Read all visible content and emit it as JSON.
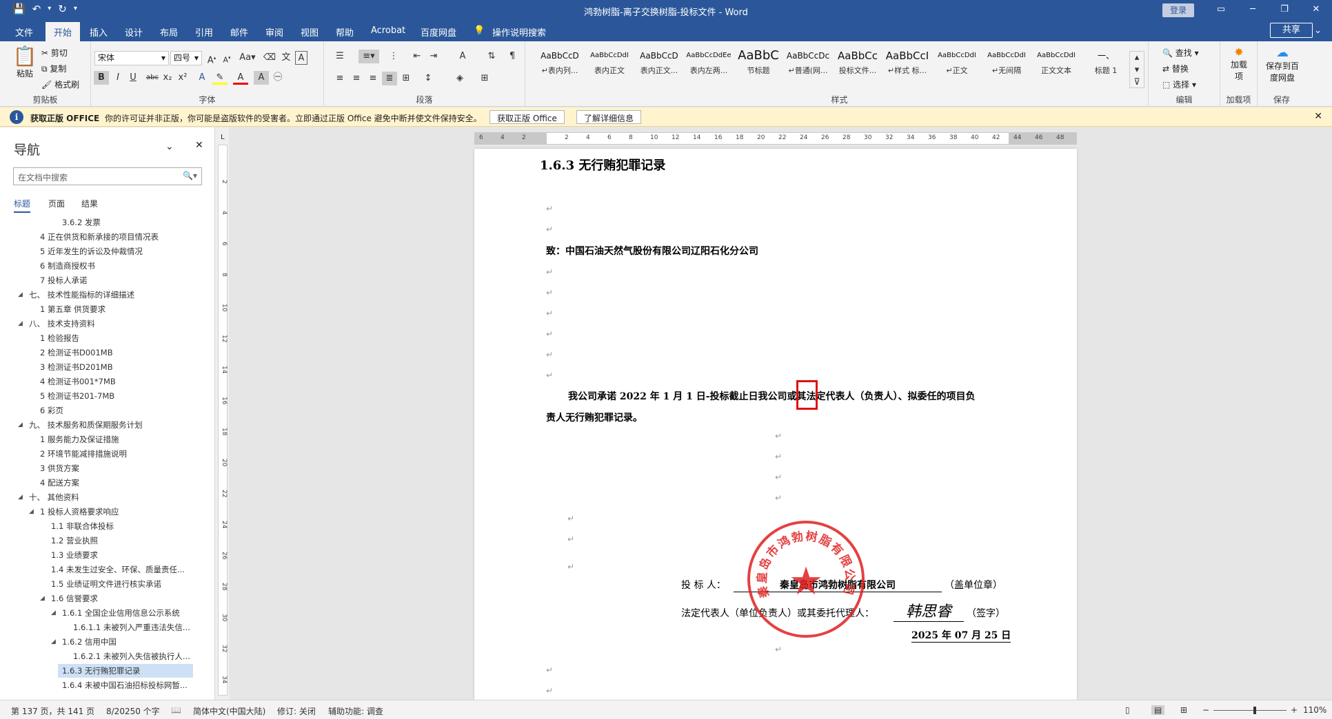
{
  "window": {
    "title": "鸿勃树脂-离子交换树脂-投标文件  -  Word",
    "login": "登录"
  },
  "tabs": [
    "文件",
    "开始",
    "插入",
    "设计",
    "布局",
    "引用",
    "邮件",
    "审阅",
    "视图",
    "帮助",
    "Acrobat",
    "百度网盘"
  ],
  "tell_me": "操作说明搜索",
  "share": "共享",
  "clipboard": {
    "paste": "粘贴",
    "cut": "剪切",
    "copy": "复制",
    "format_painter": "格式刷",
    "label": "剪贴板"
  },
  "font": {
    "name": "宋体",
    "size": "四号",
    "label": "字体",
    "aa": "Aa"
  },
  "paragraph": {
    "label": "段落"
  },
  "styles": {
    "label": "样式",
    "items": [
      {
        "preview": "AaBbCcD",
        "name": "↵表内列..."
      },
      {
        "preview": "AaBbCcDdI",
        "name": "表内正文"
      },
      {
        "preview": "AaBbCcD",
        "name": "表内正文..."
      },
      {
        "preview": "AaBbCcDdEe",
        "name": "表内左两..."
      },
      {
        "preview": "AaBbC",
        "name": "节标题"
      },
      {
        "preview": "AaBbCcDc",
        "name": "↵普通(网..."
      },
      {
        "preview": "AaBbCc",
        "name": "投标文件..."
      },
      {
        "preview": "AaBbCcI",
        "name": "↵样式 标..."
      },
      {
        "preview": "AaBbCcDdI",
        "name": "↵正文"
      },
      {
        "preview": "AaBbCcDdI",
        "name": "↵无间隔"
      },
      {
        "preview": "AaBbCcDdI",
        "name": "正文文本"
      },
      {
        "preview": "一、",
        "name": "标题 1"
      }
    ]
  },
  "editing": {
    "find": "查找",
    "replace": "替换",
    "select": "选择",
    "label": "编辑"
  },
  "addins": {
    "title": "加载项",
    "label": "加载项"
  },
  "baidu": {
    "title": "保存到百度网盘",
    "label": "保存"
  },
  "infobar": {
    "title": "获取正版 OFFICE",
    "message": "你的许可证并非正版，你可能是盗版软件的受害者。立即通过正版 Office 避免中断并使文件保持安全。",
    "btn_genuine": "获取正版 Office",
    "btn_learn": "了解详细信息"
  },
  "nav": {
    "title": "导航",
    "search_placeholder": "在文档中搜索",
    "tabs": [
      "标题",
      "页面",
      "结果"
    ],
    "items": [
      {
        "text": "3.6.2 发票",
        "level": 4,
        "toggle": ""
      },
      {
        "text": "4 正在供货和新承接的项目情况表",
        "level": 2,
        "toggle": ""
      },
      {
        "text": "5 近年发生的诉讼及仲裁情况",
        "level": 2,
        "toggle": ""
      },
      {
        "text": "6 制造商授权书",
        "level": 2,
        "toggle": ""
      },
      {
        "text": "7 投标人承诺",
        "level": 2,
        "toggle": ""
      },
      {
        "text": "七、 技术性能指标的详细描述",
        "level": 1,
        "toggle": "◢"
      },
      {
        "text": "1 第五章  供货要求",
        "level": 2,
        "toggle": ""
      },
      {
        "text": "八、 技术支持资料",
        "level": 1,
        "toggle": "◢"
      },
      {
        "text": "1 检验报告",
        "level": 2,
        "toggle": ""
      },
      {
        "text": "2 检测证书D001MB",
        "level": 2,
        "toggle": ""
      },
      {
        "text": "3 检测证书D201MB",
        "level": 2,
        "toggle": ""
      },
      {
        "text": "4 检测证书001*7MB",
        "level": 2,
        "toggle": ""
      },
      {
        "text": "5 检测证书201-7MB",
        "level": 2,
        "toggle": ""
      },
      {
        "text": "6 彩页",
        "level": 2,
        "toggle": ""
      },
      {
        "text": "九、 技术服务和质保期服务计划",
        "level": 1,
        "toggle": "◢"
      },
      {
        "text": "1 服务能力及保证措施",
        "level": 2,
        "toggle": ""
      },
      {
        "text": "2 环境节能减排措施说明",
        "level": 2,
        "toggle": ""
      },
      {
        "text": "3 供货方案",
        "level": 2,
        "toggle": ""
      },
      {
        "text": "4 配送方案",
        "level": 2,
        "toggle": ""
      },
      {
        "text": "十、 其他资料",
        "level": 1,
        "toggle": "◢"
      },
      {
        "text": "1 投标人资格要求响应",
        "level": 2,
        "toggle": "◢"
      },
      {
        "text": "1.1 非联合体投标",
        "level": 3,
        "toggle": ""
      },
      {
        "text": "1.2 营业执照",
        "level": 3,
        "toggle": ""
      },
      {
        "text": "1.3 业绩要求",
        "level": 3,
        "toggle": ""
      },
      {
        "text": "1.4 未发生过安全、环保、质量责任...",
        "level": 3,
        "toggle": ""
      },
      {
        "text": "1.5 业绩证明文件进行核实承诺",
        "level": 3,
        "toggle": ""
      },
      {
        "text": "1.6 信誉要求",
        "level": 3,
        "toggle": "◢"
      },
      {
        "text": "1.6.1 全国企业信用信息公示系统",
        "level": 4,
        "toggle": "◢"
      },
      {
        "text": "1.6.1.1 未被列入严重违法失信...",
        "level": 5,
        "toggle": ""
      },
      {
        "text": "1.6.2 信用中国",
        "level": 4,
        "toggle": "◢"
      },
      {
        "text": "1.6.2.1 未被列入失信被执行人...",
        "level": 5,
        "toggle": ""
      },
      {
        "text": "1.6.3 无行贿犯罪记录",
        "level": 4,
        "toggle": "",
        "selected": true
      },
      {
        "text": "1.6.4 未被中国石油招标投标网暂...",
        "level": 4,
        "toggle": ""
      }
    ]
  },
  "ruler": {
    "h_ticks": [
      "6",
      "4",
      "2",
      "",
      "2",
      "4",
      "6",
      "8",
      "10",
      "12",
      "14",
      "16",
      "18",
      "20",
      "22",
      "24",
      "26",
      "28",
      "30",
      "32",
      "34",
      "36",
      "38",
      "40",
      "42",
      "44",
      "46",
      "48"
    ],
    "v_ticks": [
      "2",
      "4",
      "6",
      "8",
      "10",
      "12",
      "14",
      "16",
      "18",
      "20",
      "22",
      "24",
      "26",
      "28",
      "30",
      "32",
      "34"
    ]
  },
  "document": {
    "heading": "1.6.3  无行贿犯罪记录",
    "to_line": "致：中国石油天然气股份有限公司辽阳石化分公司",
    "body_line1": "我公司承诺 2022 年 1 月 1 日-投标截止日我公司或其法定代表人（负责人）、拟委任的项目负",
    "body_line2": "责人无行贿犯罪记录。",
    "bidder_label": "投  标  人：",
    "bidder_name": "秦皇岛市鸿勃树脂有限公司",
    "bidder_suffix": "（盖单位章）",
    "rep_label": "法定代表人（单位负责人）或其委托代理人：",
    "rep_signature": "韩思睿",
    "rep_suffix": "（签字）",
    "date": "2025 年 07 月 25 日",
    "stamp_text": "秦皇岛市鸿勃树脂有限公司",
    "para_mark": "↵"
  },
  "status": {
    "page": "第 137 页，共 141 页",
    "words": "8/20250 个字",
    "lang": "简体中文(中国大陆)",
    "track": "修订: 关闭",
    "accessibility": "辅助功能: 调查",
    "zoom": "110%"
  },
  "colors": {
    "accent": "#2b579a",
    "stamp": "#e02020",
    "infobar": "#fff4ce"
  }
}
